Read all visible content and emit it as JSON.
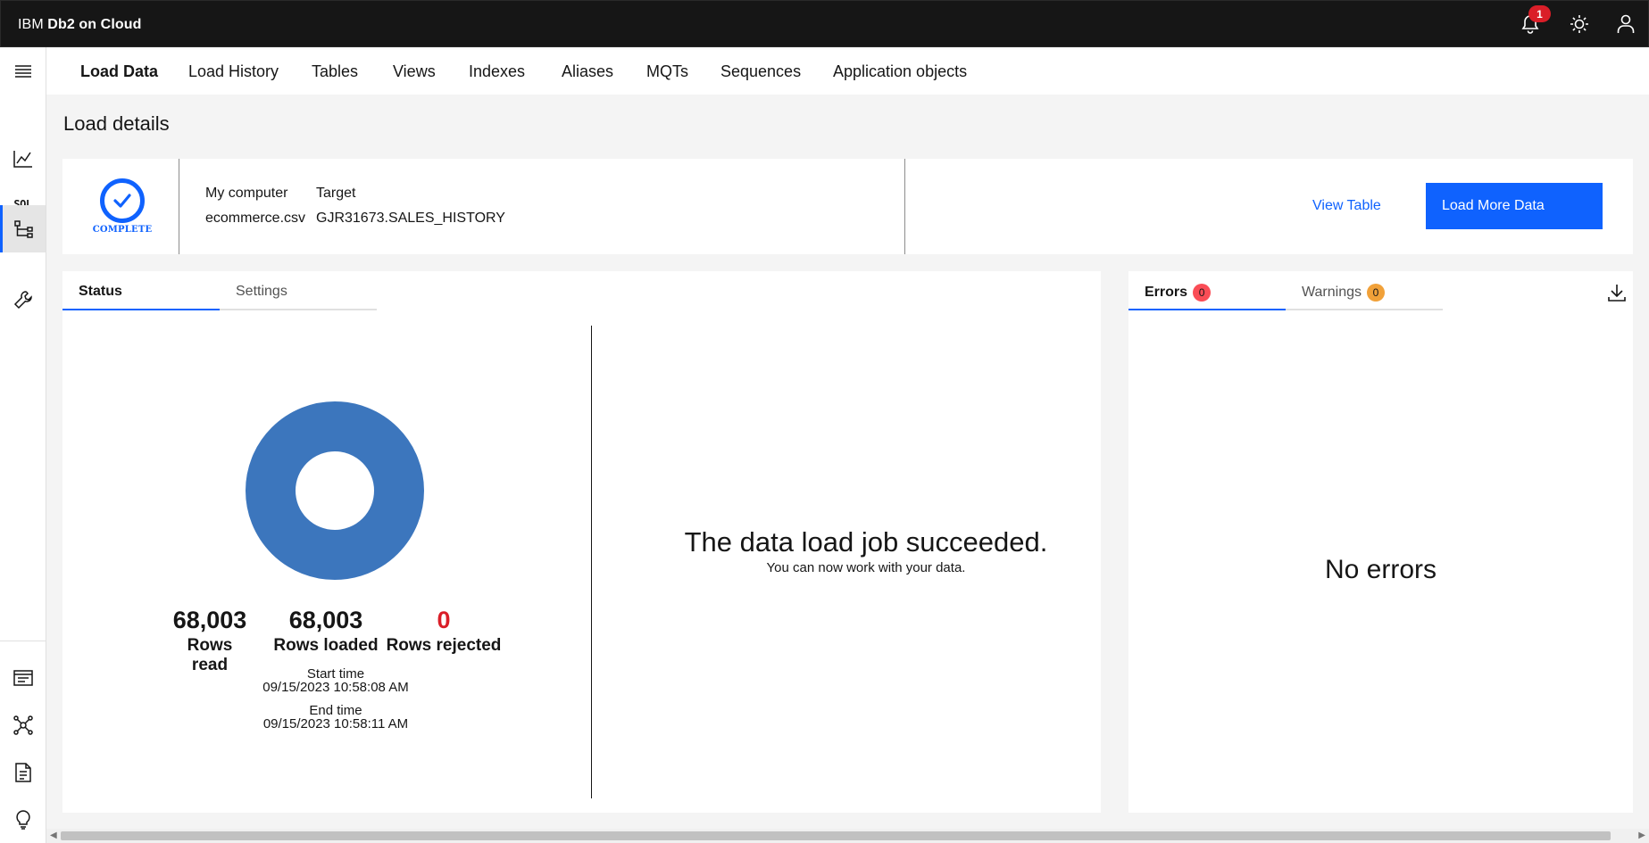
{
  "app": {
    "brand_prefix": "IBM",
    "brand_name": "Db2 on Cloud"
  },
  "topbar": {
    "icons": [
      "bell-icon",
      "sun-icon",
      "user-icon"
    ],
    "notification_count": "1"
  },
  "rail": {
    "items": [
      "menu-icon",
      "chart-icon",
      "SQL",
      "tree-icon",
      "wrench-icon"
    ],
    "bottom_items": [
      "console-icon",
      "network-icon",
      "document-icon",
      "lightbulb-icon"
    ],
    "sql_label": "SQL"
  },
  "nav": {
    "tabs": [
      "Load Data",
      "Load History",
      "Tables",
      "Views",
      "Indexes",
      "Aliases",
      "MQTs",
      "Sequences",
      "Application objects"
    ],
    "active": "Load Data"
  },
  "page": {
    "title": "Load details"
  },
  "summary": {
    "status_label": "COMPLETE",
    "source_header": "My computer",
    "source_value": "ecommerce.csv",
    "target_header": "Target",
    "target_value": "GJR31673.SALES_HISTORY",
    "view_table": "View Table",
    "load_more": "Load More Data"
  },
  "status_panel": {
    "tab_status": "Status",
    "tab_settings": "Settings",
    "rows_read": "68,003",
    "rows_read_label": "Rows read",
    "rows_loaded": "68,003",
    "rows_loaded_label": "Rows loaded",
    "rows_rejected": "0",
    "rows_rejected_label": "Rows rejected",
    "start_label": "Start time",
    "start_value": "09/15/2023 10:58:08 AM",
    "end_label": "End time",
    "end_value": "09/15/2023 10:58:11 AM",
    "success_title": "The data load job succeeded.",
    "success_sub": "You can now work with your data.",
    "donut_color": "#3c76bd",
    "loaded_fraction": 1.0
  },
  "errors_panel": {
    "tab_errors": "Errors",
    "errors_count": "0",
    "tab_warnings": "Warnings",
    "warnings_count": "0",
    "empty_message": "No errors"
  },
  "colors": {
    "accent": "#0f62fe",
    "danger": "#da1e28",
    "warning": "#f1a139",
    "topbar": "#161616"
  }
}
